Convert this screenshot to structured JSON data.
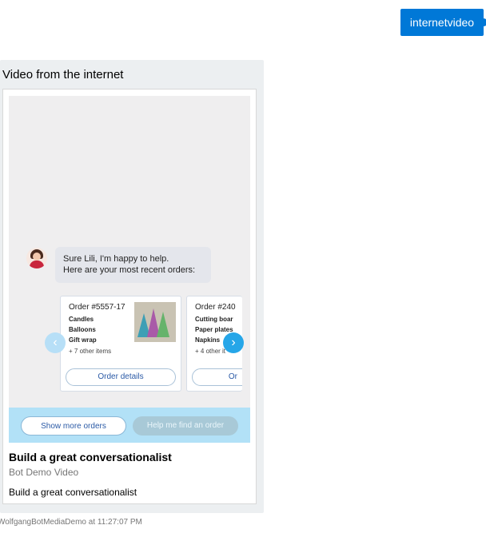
{
  "user_message": {
    "text": "internetvideo"
  },
  "bot_message": {
    "text": "Video from the internet",
    "card": {
      "title": "Build a great conversationalist",
      "subtitle": "Bot Demo Video",
      "text": "Build a great conversationalist",
      "video_preview": {
        "bot_text_line1": "Sure Lili, I'm happy to help.",
        "bot_text_line2": "Here are your most recent orders:",
        "orders": [
          {
            "title": "Order #5557-17",
            "items": [
              "Candles",
              "Balloons",
              "Gift wrap"
            ],
            "more": "+ 7 other items",
            "button": "Order details"
          },
          {
            "title": "Order #240",
            "items": [
              "Cutting boar",
              "Paper plates",
              "Napkins"
            ],
            "more": "+ 4 other it",
            "button": "Or"
          }
        ],
        "actions": [
          "Show more orders",
          "Help me find an order"
        ]
      }
    },
    "timestamp": "WolfgangBotMediaDemo at 11:27:07 PM"
  },
  "colors": {
    "user_bubble": "#0078d7",
    "bot_frame": "#eceff1",
    "action_bar": "#b2e1f7"
  }
}
